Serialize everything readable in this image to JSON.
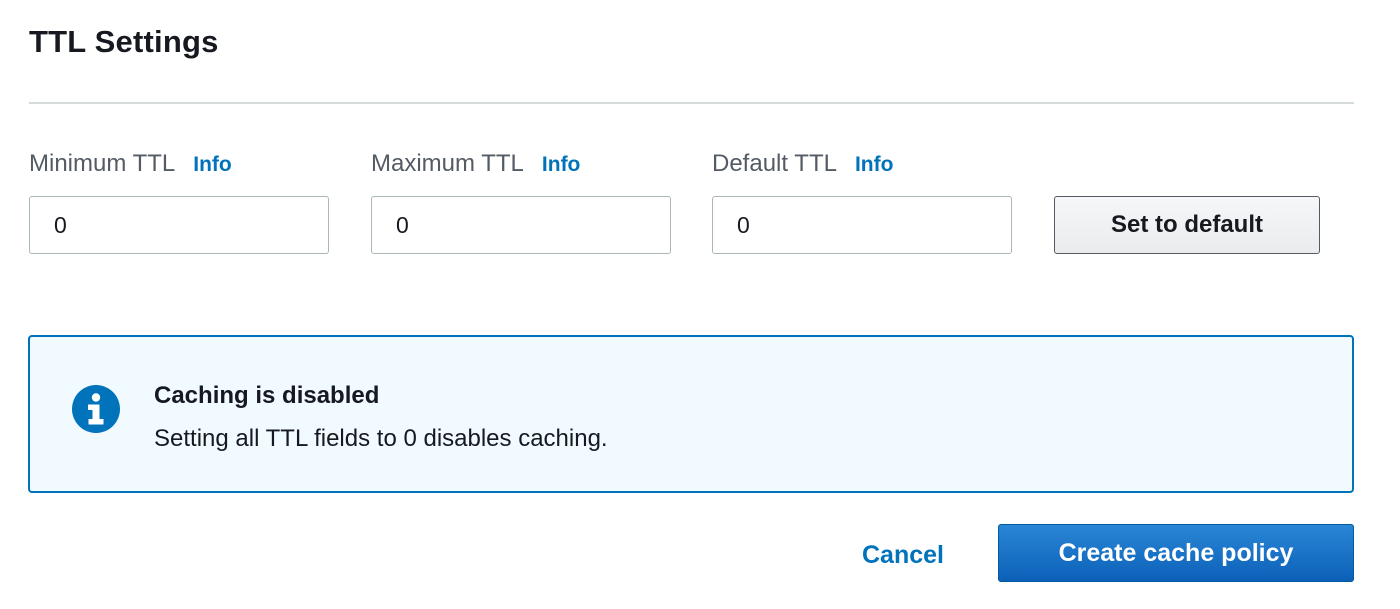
{
  "section": {
    "title": "TTL Settings"
  },
  "fields": [
    {
      "label": "Minimum TTL",
      "info": "Info",
      "value": "0"
    },
    {
      "label": "Maximum TTL",
      "info": "Info",
      "value": "0"
    },
    {
      "label": "Default TTL",
      "info": "Info",
      "value": "0"
    }
  ],
  "set_default_button": "Set to default",
  "alert": {
    "icon": "info-icon",
    "title": "Caching is disabled",
    "message": "Setting all TTL fields to 0 disables caching."
  },
  "actions": {
    "cancel_label": "Cancel",
    "create_label": "Create cache policy"
  },
  "colors": {
    "link": "#0073bb",
    "alert_border": "#0073bb",
    "alert_background": "#f1faff",
    "primary_button": "#0b61b8"
  }
}
